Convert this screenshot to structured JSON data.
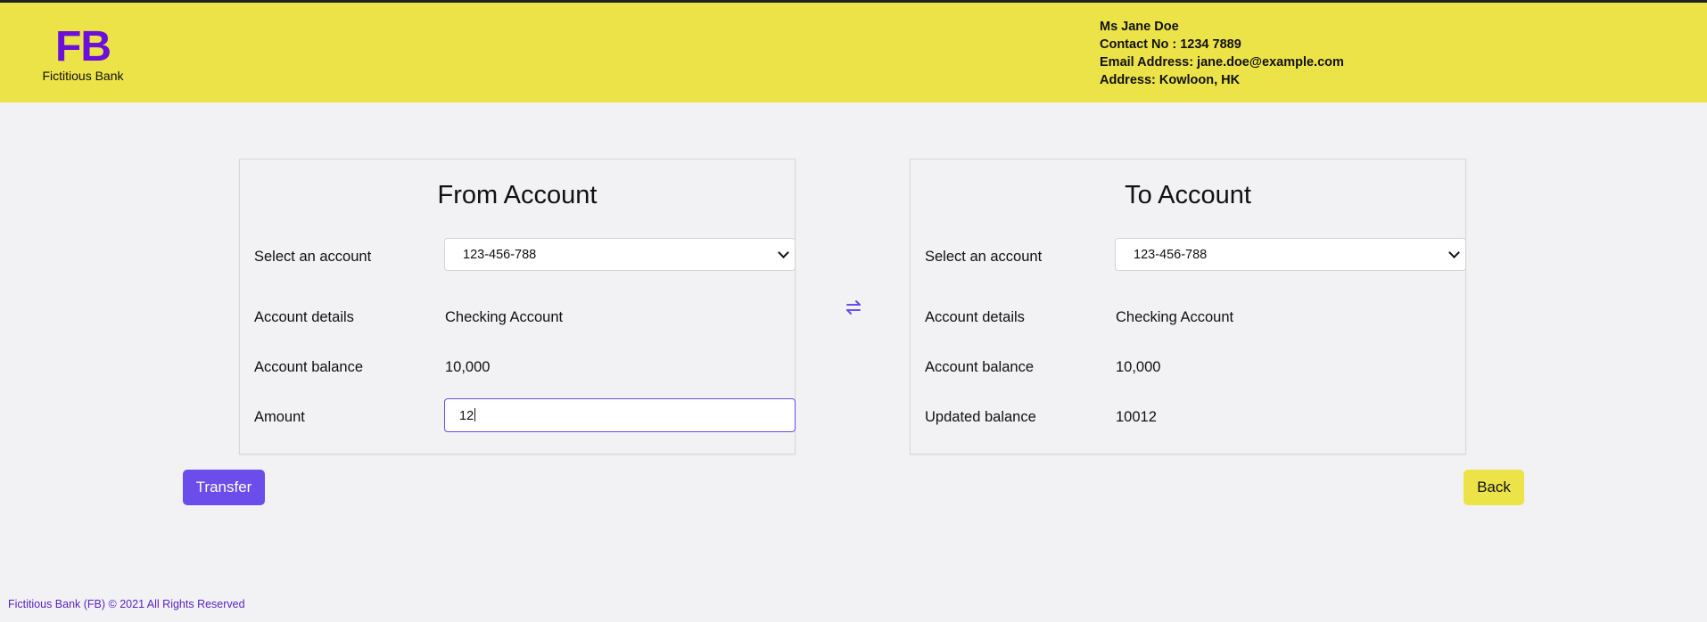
{
  "header": {
    "logo_mark": "FB",
    "logo_name": "Fictitious Bank",
    "user": {
      "name": "Ms Jane Doe",
      "contact": "Contact No : 1234 7889",
      "email": "Email Address: jane.doe@example.com",
      "address": "Address: Kowloon, HK"
    }
  },
  "from_account": {
    "title": "From Account",
    "select_label": "Select an account",
    "selected_account": "123-456-788",
    "details_label": "Account details",
    "details_value": "Checking Account",
    "balance_label": "Account balance",
    "balance_value": "10,000",
    "amount_label": "Amount",
    "amount_value": "12"
  },
  "to_account": {
    "title": "To Account",
    "select_label": "Select an account",
    "selected_account": "123-456-788",
    "details_label": "Account details",
    "details_value": "Checking Account",
    "balance_label": "Account balance",
    "balance_value": "10,000",
    "updated_label": "Updated balance",
    "updated_value": "10012"
  },
  "swap_icon": "swap-arrows-icon",
  "actions": {
    "transfer_label": "Transfer",
    "back_label": "Back"
  },
  "footer": {
    "copyright": "Fictitious Bank (FB) © 2021 All Rights Reserved"
  },
  "colors": {
    "header_bg": "#ece348",
    "brand_purple": "#6a10d8",
    "accent": "#6a4dea",
    "page_bg": "#f2f2f4"
  }
}
